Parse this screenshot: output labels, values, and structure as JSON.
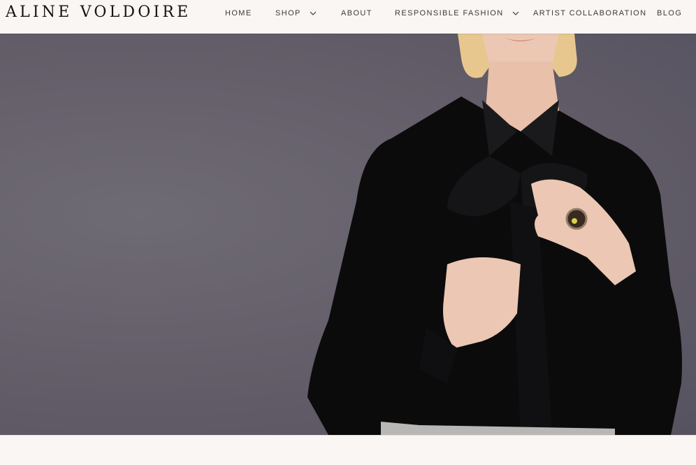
{
  "brand": {
    "name": "ALINE VOLDOIRE"
  },
  "nav": {
    "items": [
      {
        "label": "HOME",
        "dropdown": false
      },
      {
        "label": "SHOP",
        "dropdown": true
      },
      {
        "label": "ABOUT",
        "dropdown": false
      },
      {
        "label": "RESPONSIBLE FASHION",
        "dropdown": true
      },
      {
        "label": "ARTIST COLLABORATION",
        "dropdown": false
      },
      {
        "label": "BLOG",
        "dropdown": false
      }
    ]
  },
  "hero": {
    "icon": "hero-photo",
    "colors": {
      "background": "#625d68",
      "blouse": "#0b0b0c",
      "skin": "#ecc7b3",
      "hair": "#e8c78f"
    }
  }
}
